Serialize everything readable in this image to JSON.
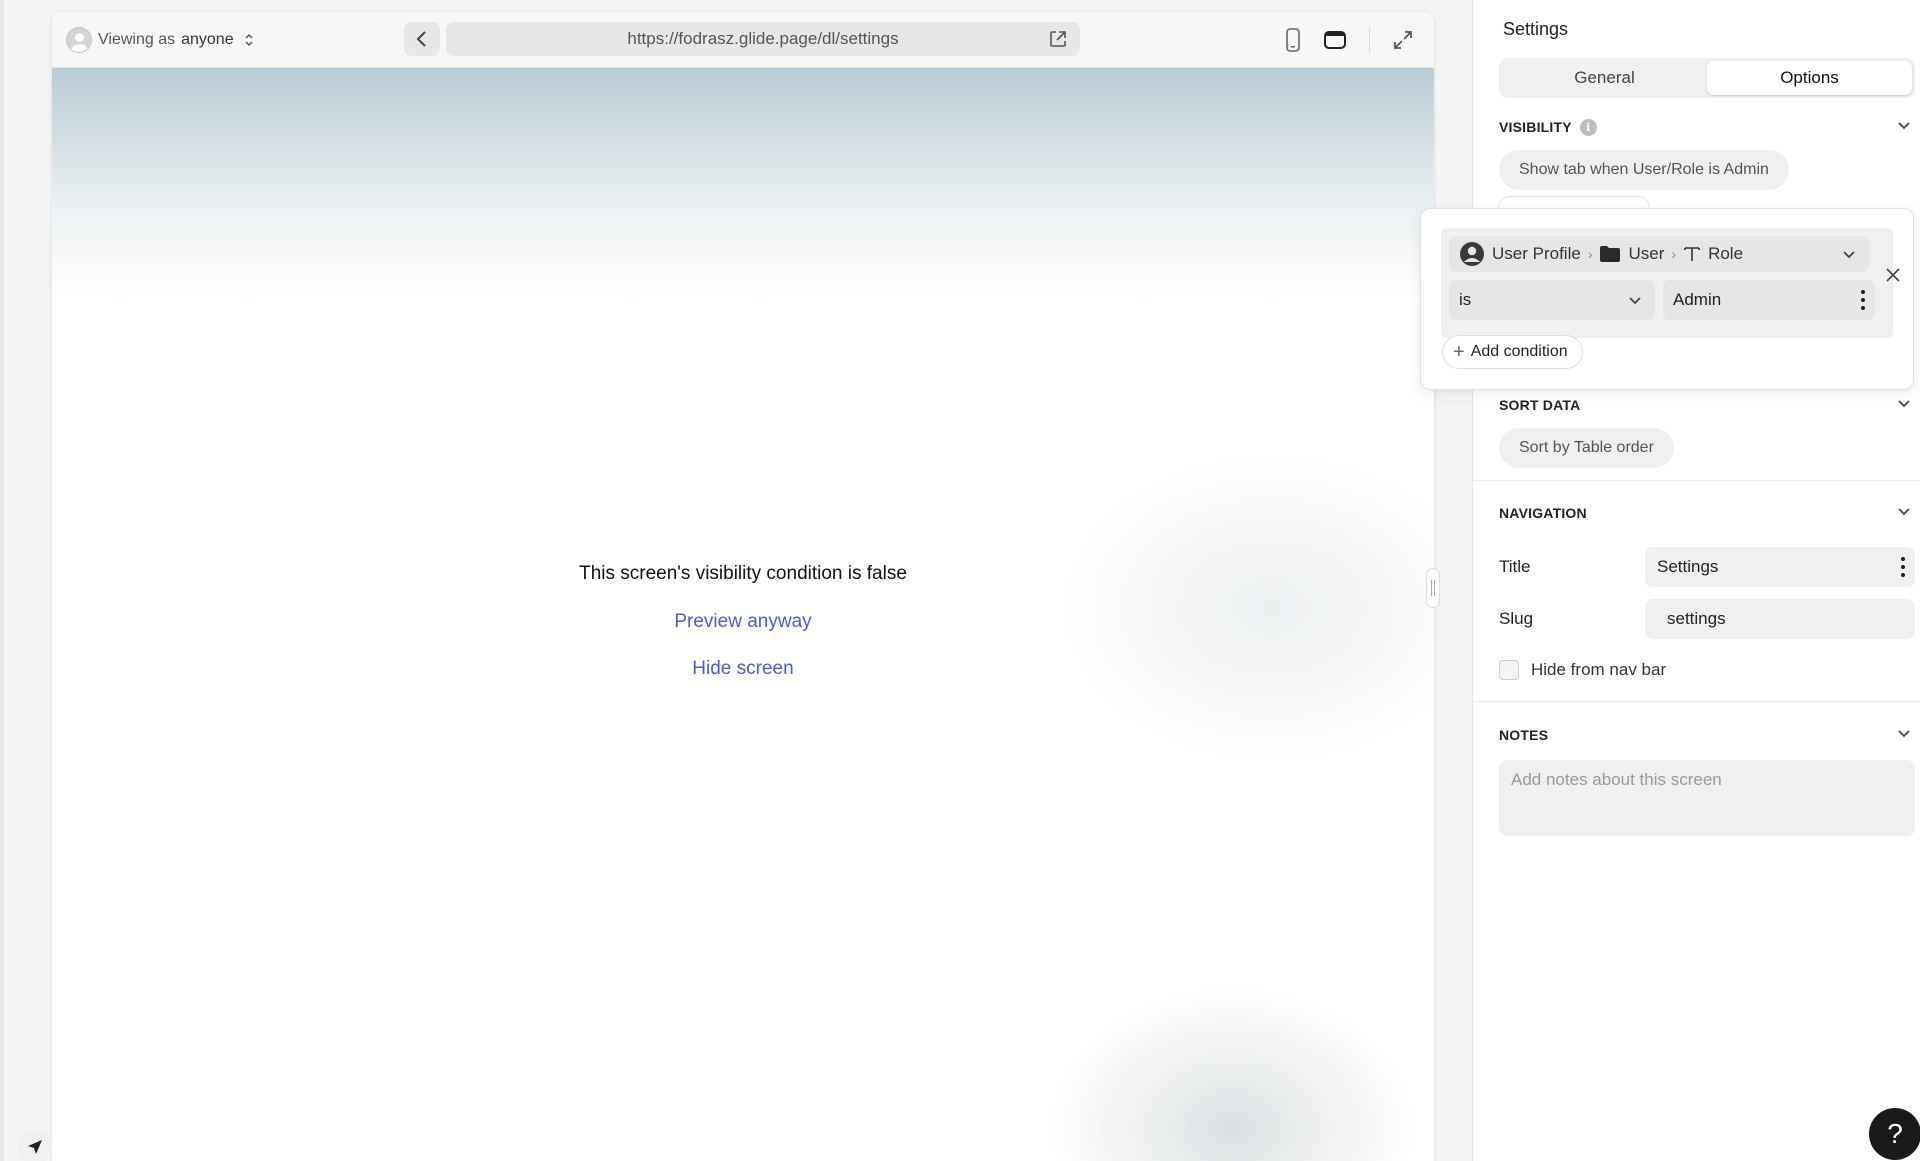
{
  "preview": {
    "viewing_as_prefix": "Viewing as",
    "viewing_as_value": "anyone",
    "url": "https://fodrasz.glide.page/dl/settings",
    "message": "This screen's visibility condition is false",
    "preview_anyway": "Preview anyway",
    "hide_screen": "Hide screen"
  },
  "panel": {
    "title": "Settings",
    "tabs": [
      {
        "label": "General",
        "active": false
      },
      {
        "label": "Options",
        "active": true
      }
    ],
    "visibility": {
      "heading": "VISIBILITY",
      "info": "i",
      "rule_summary": "Show tab when User/Role is Admin"
    },
    "sort_data": {
      "heading": "SORT DATA",
      "value": "Sort by Table order"
    },
    "navigation": {
      "heading": "NAVIGATION",
      "title_label": "Title",
      "title_value": "Settings",
      "slug_label": "Slug",
      "slug_value": "settings",
      "hide_nav_label": "Hide from nav bar",
      "hide_nav_checked": false
    },
    "notes": {
      "heading": "NOTES",
      "placeholder": "Add notes about this screen"
    }
  },
  "condition": {
    "path": [
      "User Profile",
      "User",
      "Role"
    ],
    "operator": "is",
    "value": "Admin",
    "add_label": "Add condition"
  },
  "help": "?"
}
